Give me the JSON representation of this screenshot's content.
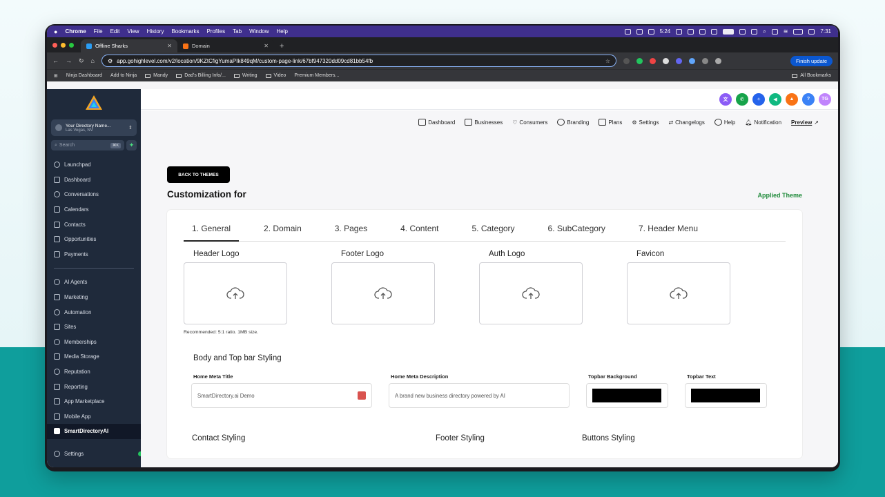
{
  "menubar": {
    "app": "Chrome",
    "items": [
      "File",
      "Edit",
      "View",
      "History",
      "Bookmarks",
      "Profiles",
      "Tab",
      "Window",
      "Help"
    ],
    "timer": "5:24",
    "clock": "7:31"
  },
  "browser": {
    "tabs": [
      {
        "title": "Offline Sharks",
        "color": "#2a9df4"
      },
      {
        "title": "Domain",
        "color": "#f97316"
      }
    ],
    "url": "app.gohighlevel.com/v2/location/9KZtCfigYumaPIk849qM/custom-page-link/67bf947320dd09cd81bb54fb",
    "finish_update": "Finish update",
    "bookmarks": [
      "Ninja Dashboard",
      "Add to Ninja",
      "Mandy",
      "Dad's Billing Info/...",
      "Writing",
      "Video",
      "Premium Members..."
    ],
    "all_bookmarks": "All Bookmarks"
  },
  "sidebar": {
    "account_name": "Your Directory Name...",
    "account_location": "Las Vegas, NV",
    "search_placeholder": "Search",
    "search_shortcut": "⌘K",
    "nav_primary": [
      "Launchpad",
      "Dashboard",
      "Conversations",
      "Calendars",
      "Contacts",
      "Opportunities",
      "Payments"
    ],
    "nav_secondary": [
      "AI Agents",
      "Marketing",
      "Automation",
      "Sites",
      "Memberships",
      "Media Storage",
      "Reputation",
      "Reporting",
      "App Marketplace",
      "Mobile App",
      "SmartDirectoryAI"
    ],
    "active_item": "SmartDirectoryAI",
    "settings": "Settings"
  },
  "topbar": {
    "avatar_initials": "TG",
    "icon_colors": [
      "#8b5cf6",
      "#16a34a",
      "#2563eb",
      "#10b981",
      "#f97316",
      "#3b82f6",
      "#c084fc"
    ]
  },
  "subnav": {
    "items": [
      "Dashboard",
      "Businesses",
      "Consumers",
      "Branding",
      "Plans",
      "Settings",
      "Changelogs",
      "Help",
      "Notification"
    ],
    "preview": "Preview"
  },
  "page": {
    "back_button": "BACK TO THEMES",
    "title": "Customization for",
    "applied_theme": "Applied Theme"
  },
  "tabs": [
    "1. General",
    "2. Domain",
    "3. Pages",
    "4. Content",
    "5. Category",
    "6. SubCategory",
    "7. Header Menu"
  ],
  "logos": {
    "items": [
      "Header Logo",
      "Footer Logo",
      "Auth Logo",
      "Favicon"
    ],
    "recommendation": "Recommended: 5:1 ratio. 1MB size."
  },
  "styling": {
    "section_title": "Body and Top bar Styling",
    "meta_title_label": "Home Meta Title",
    "meta_title_value": "SmartDirectory.ai Demo",
    "meta_desc_label": "Home Meta Description",
    "meta_desc_value": "A brand new business directory powered by AI",
    "topbar_bg_label": "Topbar Background",
    "topbar_bg_color": "#000000",
    "topbar_text_label": "Topbar Text",
    "topbar_text_color": "#000000"
  },
  "lower_sections": [
    "Contact Styling",
    "Footer Styling",
    "Buttons Styling"
  ]
}
